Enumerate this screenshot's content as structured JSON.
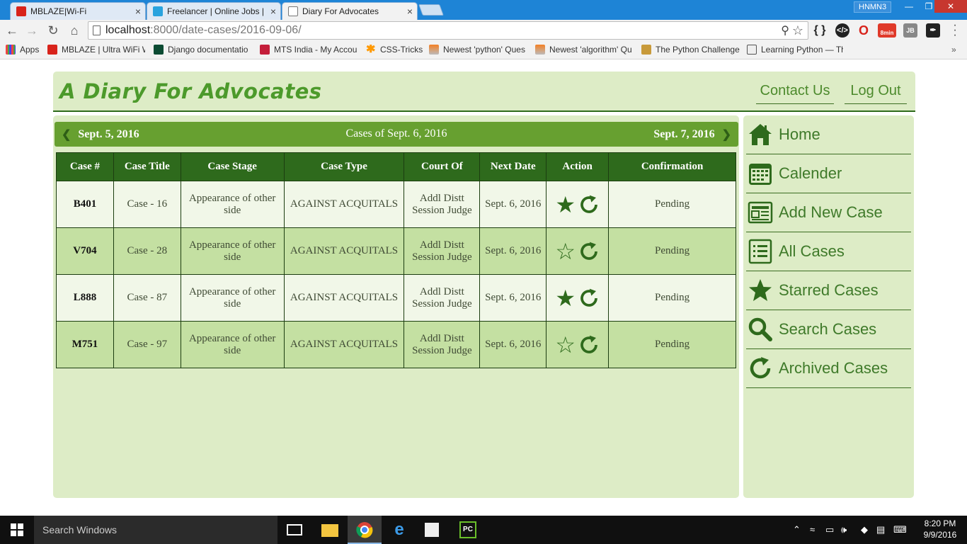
{
  "browser": {
    "tabs": [
      {
        "label": "MBLAZE|Wi-Fi",
        "close": "×"
      },
      {
        "label": "Freelancer | Online Jobs | F",
        "close": "×"
      },
      {
        "label": "Diary For Advocates",
        "close": "×"
      }
    ],
    "profile": "HNMN3",
    "url_host": "localhost",
    "url_rest": ":8000/date-cases/2016-09-06/",
    "ext_badge": "8min",
    "bookmarks": [
      "Apps",
      "MBLAZE | Ultra WiFi W",
      "Django documentatio",
      "MTS India - My Accou",
      "CSS-Tricks",
      "Newest 'python' Ques",
      "Newest 'algorithm' Qu",
      "The Python Challenge",
      "Learning Python — Th"
    ],
    "bookmarks_more": "»"
  },
  "site": {
    "brand": "A Diary For Advocates",
    "contact": "Contact Us",
    "logout": "Log Out"
  },
  "datebar": {
    "prev": "Sept. 5, 2016",
    "title": "Cases of Sept. 6, 2016",
    "next": "Sept. 7, 2016"
  },
  "table": {
    "headers": [
      "Case #",
      "Case Title",
      "Case Stage",
      "Case Type",
      "Court Of",
      "Next Date",
      "Action",
      "Confirmation"
    ],
    "rows": [
      {
        "no": "B401",
        "title": "Case - 16",
        "stage": "Appearance of other side",
        "type": "AGAINST ACQUITALS",
        "court": "Addl Distt Session Judge",
        "next": "Sept. 6, 2016",
        "starred": true,
        "status": "Pending"
      },
      {
        "no": "V704",
        "title": "Case - 28",
        "stage": "Appearance of other side",
        "type": "AGAINST ACQUITALS",
        "court": "Addl Distt Session Judge",
        "next": "Sept. 6, 2016",
        "starred": false,
        "status": "Pending"
      },
      {
        "no": "L888",
        "title": "Case - 87",
        "stage": "Appearance of other side",
        "type": "AGAINST ACQUITALS",
        "court": "Addl Distt Session Judge",
        "next": "Sept. 6, 2016",
        "starred": true,
        "status": "Pending"
      },
      {
        "no": "M751",
        "title": "Case - 97",
        "stage": "Appearance of other side",
        "type": "AGAINST ACQUITALS",
        "court": "Addl Distt Session Judge",
        "next": "Sept. 6, 2016",
        "starred": false,
        "status": "Pending"
      }
    ]
  },
  "sidebar": {
    "items": [
      {
        "label": "Home",
        "icon": "home-icon"
      },
      {
        "label": "Calender",
        "icon": "calendar-icon"
      },
      {
        "label": "Add New Case",
        "icon": "newspaper-icon"
      },
      {
        "label": "All Cases",
        "icon": "list-icon"
      },
      {
        "label": "Starred Cases",
        "icon": "star-icon"
      },
      {
        "label": "Search Cases",
        "icon": "search-icon"
      },
      {
        "label": "Archived Cases",
        "icon": "refresh-icon"
      }
    ]
  },
  "taskbar": {
    "search_placeholder": "Search Windows",
    "time": "8:20 PM",
    "date": "9/9/2016"
  },
  "colors": {
    "accent": "#67a030",
    "dark_green": "#2e6a1c",
    "panel": "#ddecc6",
    "row_alt": "#c4e0a2"
  }
}
